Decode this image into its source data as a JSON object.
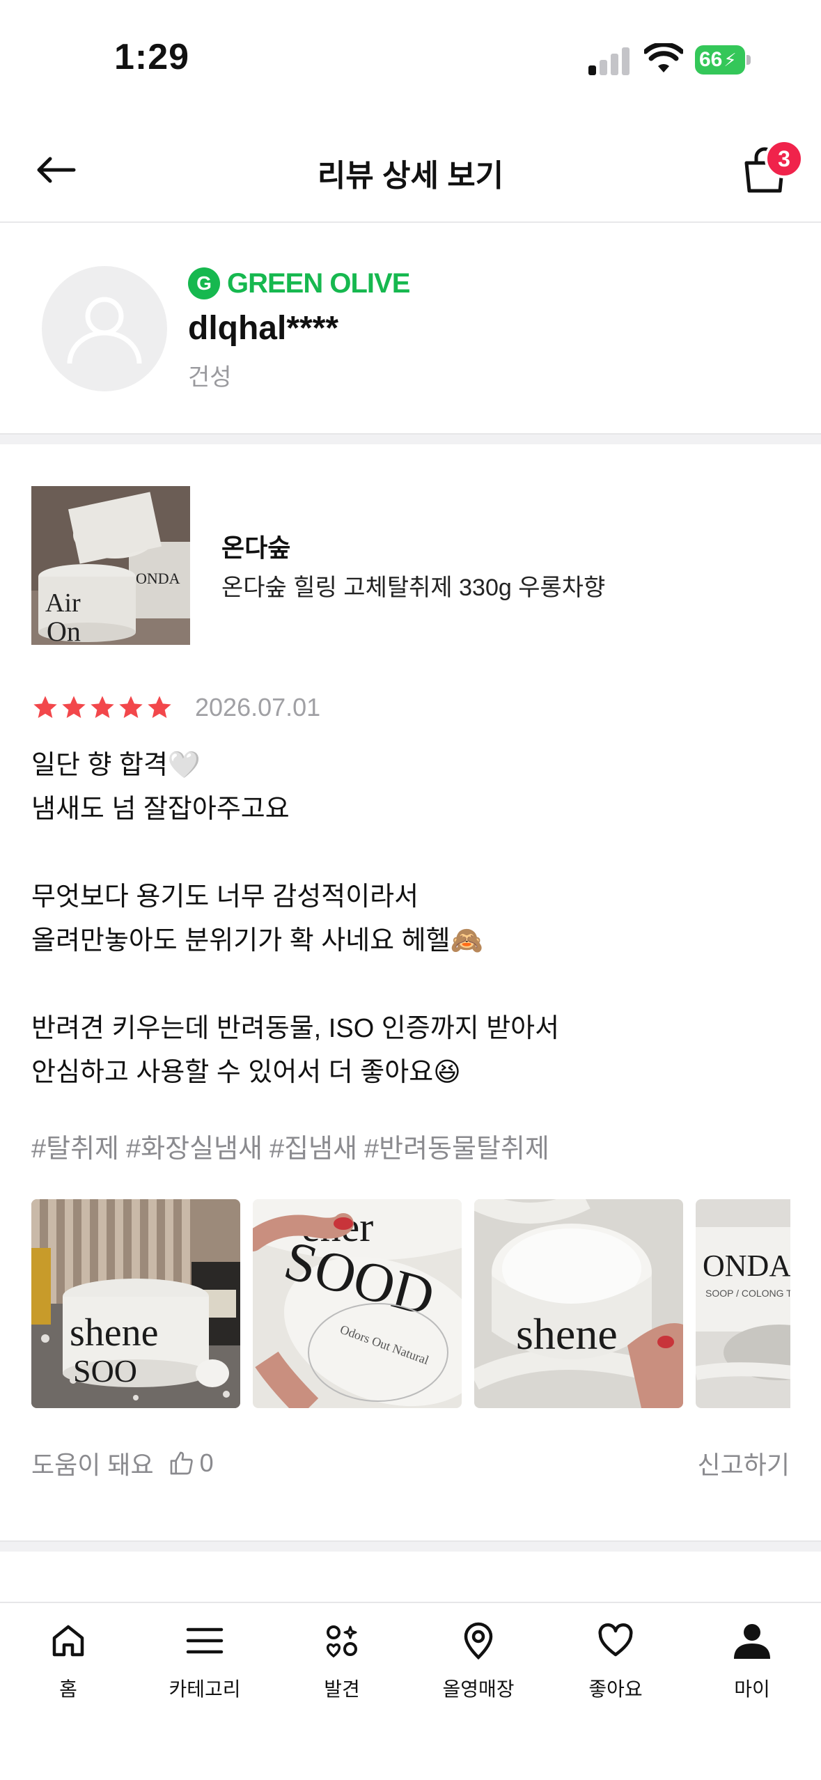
{
  "status": {
    "time": "1:29",
    "battery": "66"
  },
  "header": {
    "title": "리뷰 상세 보기",
    "cart_count": "3"
  },
  "profile": {
    "grade": "GREEN OLIVE",
    "grade_letter": "G",
    "username": "dlqhal****",
    "skin_type": "건성"
  },
  "product": {
    "brand": "온다숲",
    "name": "온다숲 힐링 고체탈취제 330g 우롱차향"
  },
  "review": {
    "rating": 5,
    "date": "2026.07.01",
    "lines": [
      "일단 향 합격🤍",
      "냄새도 넘 잘잡아주고요",
      "",
      "무엇보다 용기도 너무 감성적이라서",
      "올려만놓아도 분위기가 확 사네요 헤헬🙈",
      "",
      "반려견 키우는데 반려동물, ISO 인증까지 받아서",
      "안심하고 사용할 수 있어서 더 좋아요😆"
    ],
    "hashtags": [
      "#탈취제",
      "#화장실냄새",
      "#집냄새",
      "#반려동물탈취제"
    ],
    "helpful_label": "도움이 돼요",
    "like_count": "0",
    "report_label": "신고하기"
  },
  "colors": {
    "accent_green": "#16b84f",
    "badge_red": "#f0234b",
    "star": "#f2474b"
  },
  "tabs": [
    {
      "label": "홈",
      "icon": "home-icon"
    },
    {
      "label": "카테고리",
      "icon": "menu-icon"
    },
    {
      "label": "발견",
      "icon": "discover-icon"
    },
    {
      "label": "올영매장",
      "icon": "location-pin-icon"
    },
    {
      "label": "좋아요",
      "icon": "heart-icon"
    },
    {
      "label": "마이",
      "icon": "person-icon"
    }
  ]
}
